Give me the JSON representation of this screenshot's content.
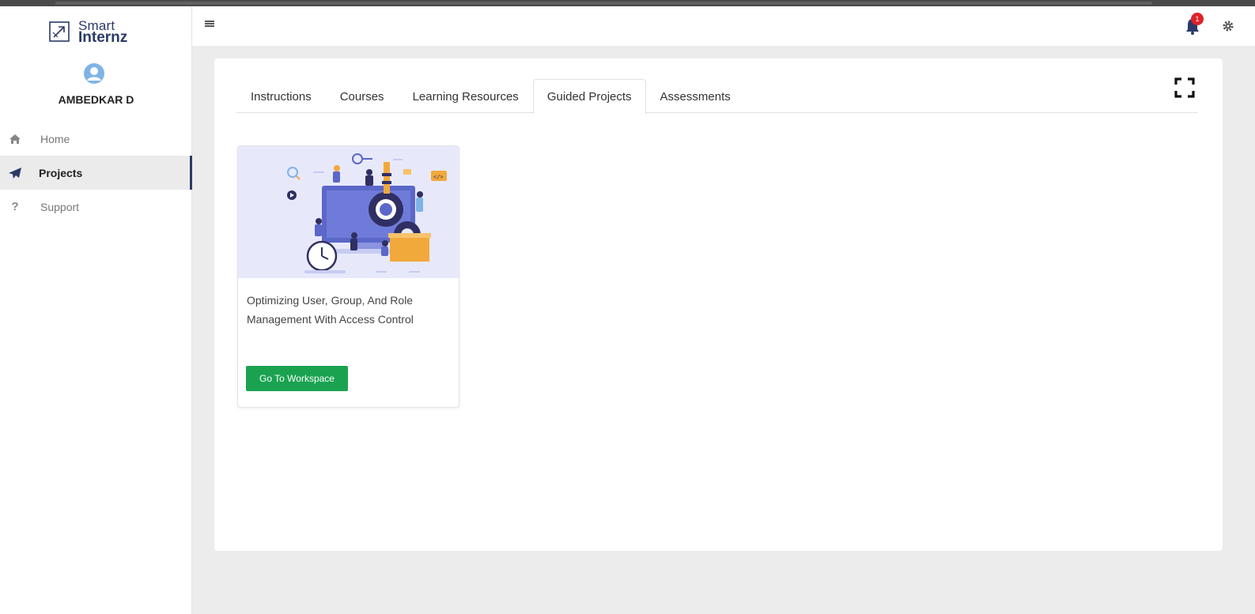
{
  "brand": {
    "line1": "Smart",
    "line2": "Internz"
  },
  "user": {
    "name": "AMBEDKAR D"
  },
  "sidebar": {
    "items": [
      {
        "label": "Home",
        "icon": "home-icon",
        "active": false
      },
      {
        "label": "Projects",
        "icon": "paper-plane-icon",
        "active": true
      },
      {
        "label": "Support",
        "icon": "question-icon",
        "active": false
      }
    ]
  },
  "topbar": {
    "notification_count": "1"
  },
  "tabs": [
    {
      "label": "Instructions",
      "active": false
    },
    {
      "label": "Courses",
      "active": false
    },
    {
      "label": "Learning Resources",
      "active": false
    },
    {
      "label": "Guided Projects",
      "active": true
    },
    {
      "label": "Assessments",
      "active": false
    }
  ],
  "project": {
    "title": "Optimizing User, Group, And Role Management With Access Control",
    "button_label": "Go To Workspace"
  },
  "colors": {
    "brand": "#2b3a67",
    "button": "#1aa251",
    "badge": "#e0202a",
    "background": "#ececec",
    "illustration_bg": "#e7e9fb"
  }
}
